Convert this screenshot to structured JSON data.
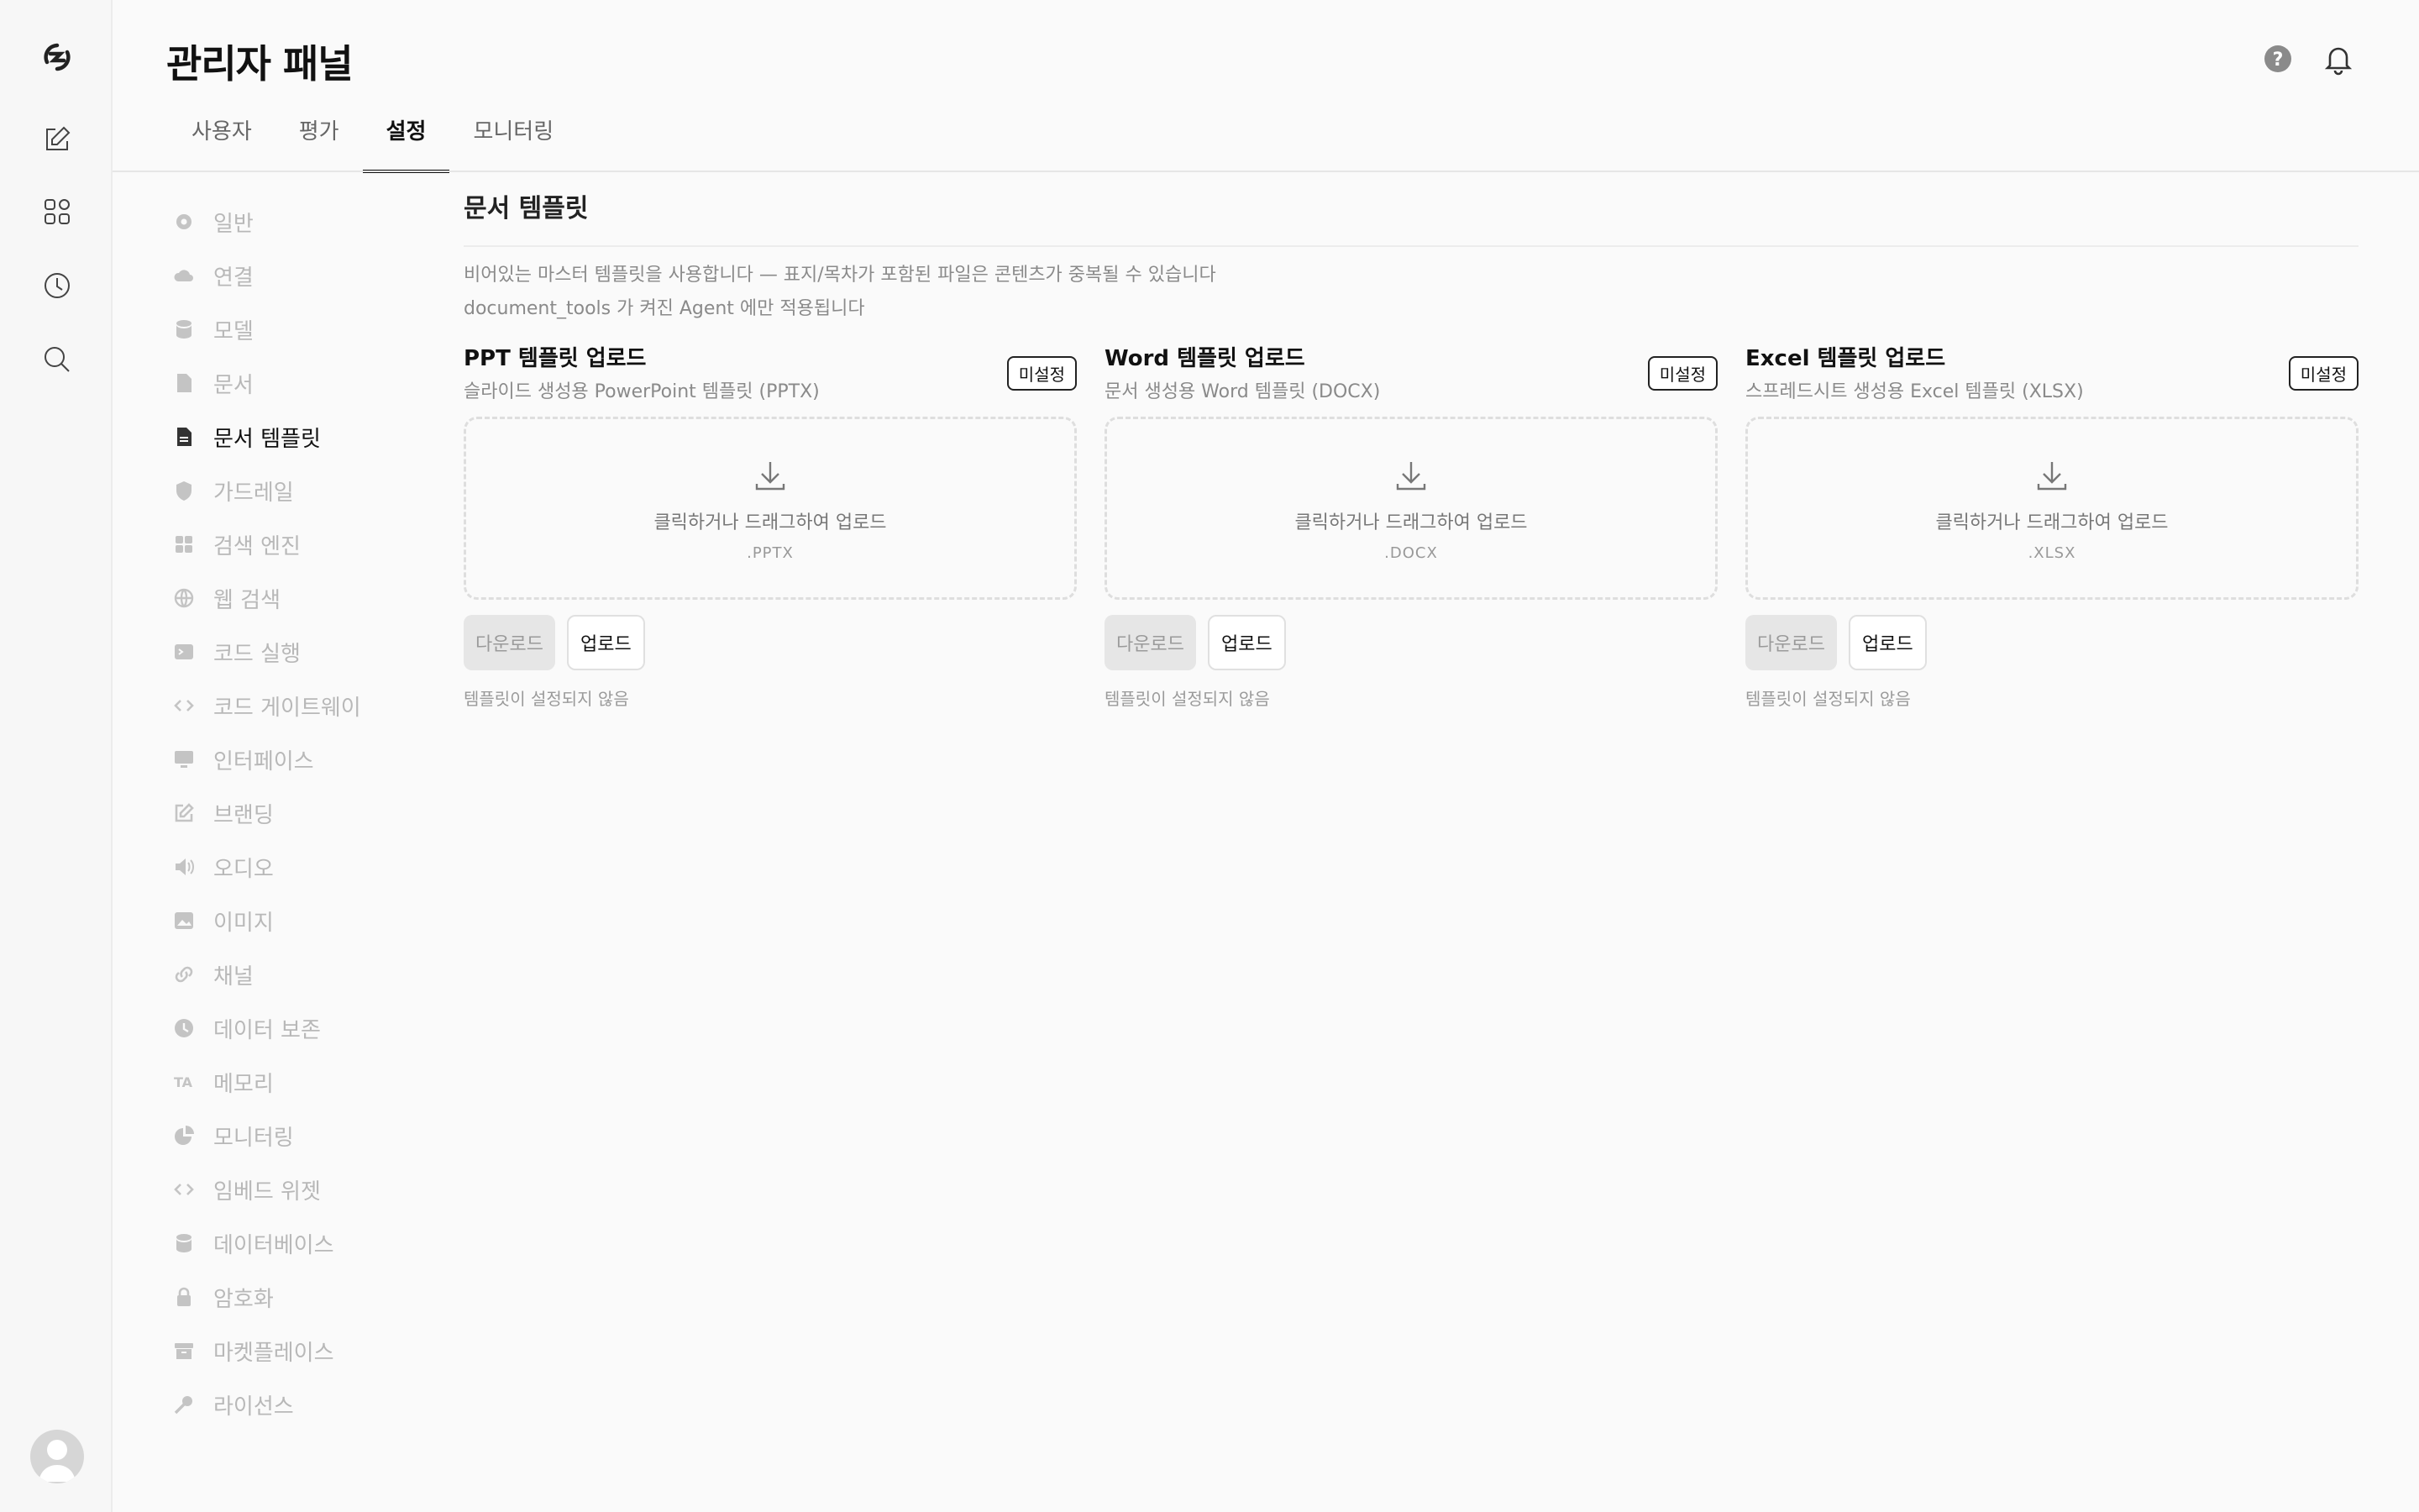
{
  "header": {
    "title": "관리자 패널"
  },
  "tabs": [
    {
      "label": "사용자"
    },
    {
      "label": "평가"
    },
    {
      "label": "설정",
      "active": true
    },
    {
      "label": "모니터링"
    }
  ],
  "sidebar": {
    "items": [
      {
        "label": "일반",
        "icon": "gear-icon"
      },
      {
        "label": "연결",
        "icon": "cloud-icon"
      },
      {
        "label": "모델",
        "icon": "database-icon"
      },
      {
        "label": "문서",
        "icon": "document-icon"
      },
      {
        "label": "문서 템플릿",
        "icon": "document-template-icon",
        "active": true
      },
      {
        "label": "가드레일",
        "icon": "shield-icon"
      },
      {
        "label": "검색 엔진",
        "icon": "grid-icon"
      },
      {
        "label": "웹 검색",
        "icon": "globe-icon"
      },
      {
        "label": "코드 실행",
        "icon": "terminal-icon"
      },
      {
        "label": "코드 게이트웨이",
        "icon": "code-icon"
      },
      {
        "label": "인터페이스",
        "icon": "monitor-icon"
      },
      {
        "label": "브랜딩",
        "icon": "edit-icon"
      },
      {
        "label": "오디오",
        "icon": "speaker-icon"
      },
      {
        "label": "이미지",
        "icon": "image-icon"
      },
      {
        "label": "채널",
        "icon": "link-icon"
      },
      {
        "label": "데이터 보존",
        "icon": "clock-icon"
      },
      {
        "label": "메모리",
        "icon": "translate-icon"
      },
      {
        "label": "모니터링",
        "icon": "chart-icon"
      },
      {
        "label": "임베드 위젯",
        "icon": "code-icon"
      },
      {
        "label": "데이터베이스",
        "icon": "database-icon"
      },
      {
        "label": "암호화",
        "icon": "lock-icon"
      },
      {
        "label": "마켓플레이스",
        "icon": "archive-icon"
      },
      {
        "label": "라이선스",
        "icon": "key-icon"
      }
    ]
  },
  "main": {
    "section_title": "문서 템플릿",
    "description_line1": "비어있는 마스터 템플릿을 사용합니다 — 표지/목차가 포함된 파일은 콘텐츠가 중복될 수 있습니다",
    "description_line2": "document_tools 가 켜진 Agent 에만 적용됩니다",
    "cards": [
      {
        "title": "PPT 템플릿 업로드",
        "subtitle": "슬라이드 생성용 PowerPoint 템플릿 (PPTX)",
        "badge": "미설정",
        "drop_text": "클릭하거나 드래그하여 업로드",
        "ext": ".PPTX",
        "download_label": "다운로드",
        "upload_label": "업로드",
        "status": "템플릿이 설정되지 않음"
      },
      {
        "title": "Word 템플릿 업로드",
        "subtitle": "문서 생성용 Word 템플릿 (DOCX)",
        "badge": "미설정",
        "drop_text": "클릭하거나 드래그하여 업로드",
        "ext": ".DOCX",
        "download_label": "다운로드",
        "upload_label": "업로드",
        "status": "템플릿이 설정되지 않음"
      },
      {
        "title": "Excel 템플릿 업로드",
        "subtitle": "스프레드시트 생성용 Excel 템플릿 (XLSX)",
        "badge": "미설정",
        "drop_text": "클릭하거나 드래그하여 업로드",
        "ext": ".XLSX",
        "download_label": "다운로드",
        "upload_label": "업로드",
        "status": "템플릿이 설정되지 않음"
      }
    ]
  },
  "colors": {
    "text": "#111111",
    "muted": "#8a8a8a",
    "sidebar_inactive": "#b8b8b8",
    "background": "#fafafa"
  }
}
